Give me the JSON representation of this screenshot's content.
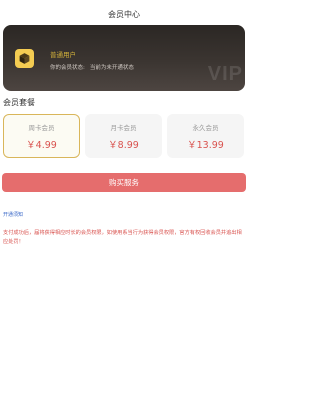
{
  "header": {
    "title": "会员中心"
  },
  "member_card": {
    "avatar_icon": "box-icon",
    "user_name": "普通用户",
    "status_label": "你的会员状态:",
    "status_value": "当前为未开通状态",
    "watermark": "VIP"
  },
  "plans_section": {
    "title": "会员套餐",
    "plans": [
      {
        "name": "周卡会员",
        "price": "￥4.99",
        "selected": true
      },
      {
        "name": "月卡会员",
        "price": "￥8.99",
        "selected": false
      },
      {
        "name": "永久会员",
        "price": "￥13.99",
        "selected": false
      }
    ]
  },
  "buy_button": {
    "label": "购买服务"
  },
  "notice": {
    "title": "开通须知",
    "text": "支付成功后，届将获得相应时长的会员权限，如使用系当行为获得会员权限，官方有权回收会员并追出相应处罚！"
  },
  "colors": {
    "accent_red": "#e56d6d",
    "price_red": "#d9534f",
    "gold": "#d9b65a",
    "card_dark": "#2b2724",
    "link_blue": "#3a68c8"
  }
}
